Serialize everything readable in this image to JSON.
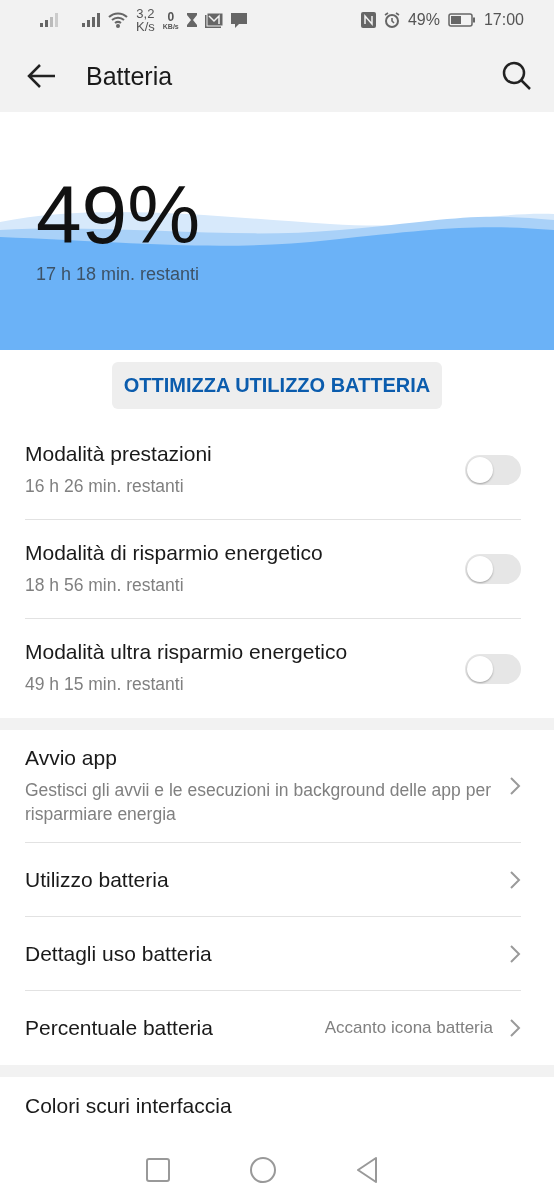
{
  "status_bar": {
    "speed_value": "3,2",
    "speed_unit": "K/s",
    "data_value": "0",
    "data_unit": "KB/s",
    "battery_percent": "49%",
    "time": "17:00"
  },
  "header": {
    "title": "Batteria"
  },
  "battery": {
    "percent": "49%",
    "remaining": "17 h 18 min. restanti"
  },
  "optimize_button": "OTTIMIZZA UTILIZZO BATTERIA",
  "modes": [
    {
      "title": "Modalità prestazioni",
      "subtitle": "16 h 26 min. restanti",
      "on": false
    },
    {
      "title": "Modalità di risparmio energetico",
      "subtitle": "18 h 56 min. restanti",
      "on": false
    },
    {
      "title": "Modalità ultra risparmio energetico",
      "subtitle": "49 h 15 min. restanti",
      "on": false
    }
  ],
  "settings": [
    {
      "title": "Avvio app",
      "subtitle": "Gestisci gli avvii e le esecuzioni in background delle app per risparmiare energia"
    },
    {
      "title": "Utilizzo batteria"
    },
    {
      "title": "Dettagli uso batteria"
    },
    {
      "title": "Percentuale batteria",
      "value": "Accanto icona batteria"
    }
  ],
  "more_settings": [
    {
      "title": "Colori scuri interfaccia"
    }
  ]
}
